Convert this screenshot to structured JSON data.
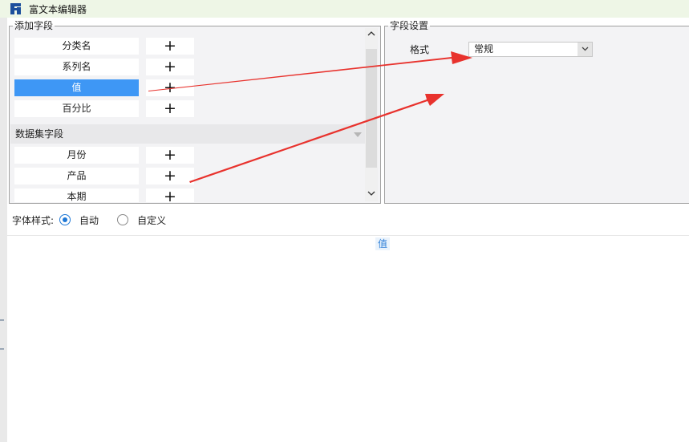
{
  "window": {
    "title": "富文本编辑器",
    "icon": "fine-report-logo-icon"
  },
  "add_fields": {
    "legend": "添加字段",
    "chart_fields": [
      {
        "label": "分类名",
        "selected": false
      },
      {
        "label": "系列名",
        "selected": false
      },
      {
        "label": "值",
        "selected": true
      },
      {
        "label": "百分比",
        "selected": false
      }
    ],
    "dataset_header": "数据集字段",
    "dataset_fields": [
      {
        "label": "月份"
      },
      {
        "label": "产品"
      },
      {
        "label": "本期"
      }
    ],
    "add_glyph": "+"
  },
  "field_settings": {
    "legend": "字段设置",
    "format_label": "格式",
    "format_value": "常规"
  },
  "font_style": {
    "label": "字体样式:",
    "options": [
      {
        "label": "自动",
        "checked": true
      },
      {
        "label": "自定义",
        "checked": false
      }
    ]
  },
  "editor": {
    "content_token": "值"
  },
  "colors": {
    "selected_bg": "#3e97f5",
    "title_bar_bg": "#eef6e6",
    "annotation_arrow": "#e8322d",
    "radio_accent": "#1f78d6"
  }
}
